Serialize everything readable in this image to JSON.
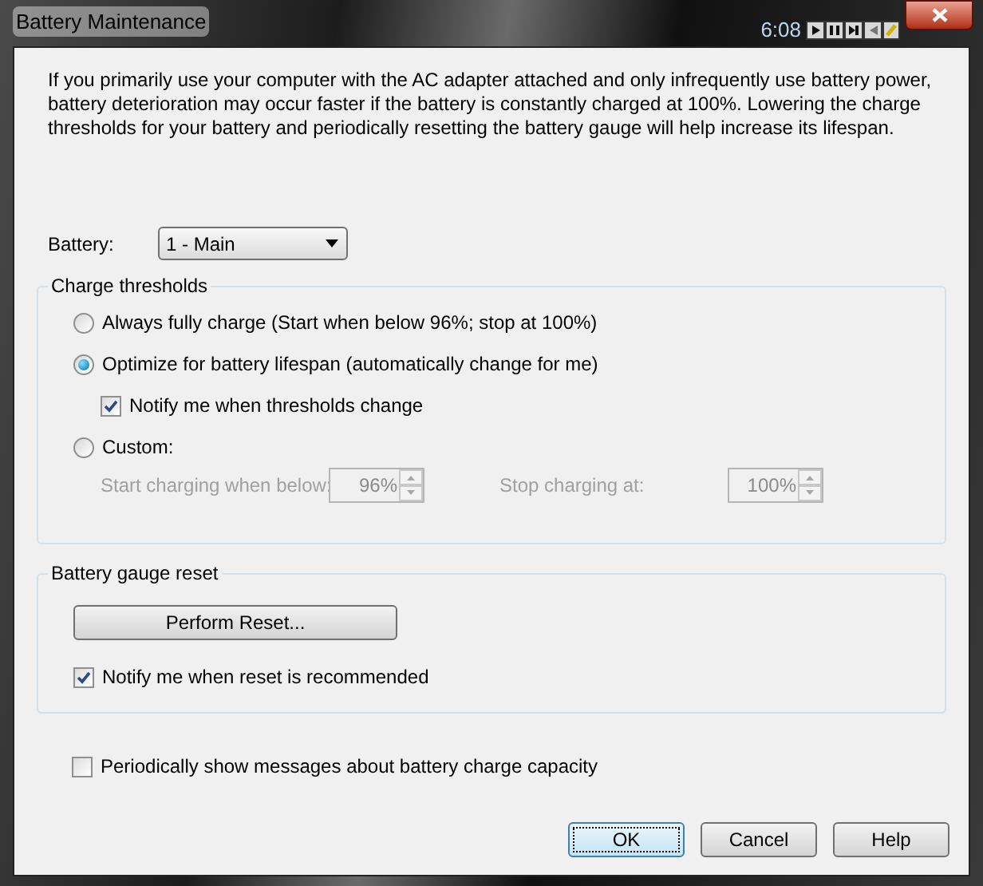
{
  "window": {
    "title": "Battery Maintenance",
    "clock": "6:08"
  },
  "intro": "If you primarily use your computer with the AC adapter attached and only infrequently use battery power, battery deterioration may occur faster if the battery is constantly charged at 100%. Lowering the charge thresholds for your battery and periodically resetting the battery gauge will help increase its lifespan.",
  "battery": {
    "label": "Battery:",
    "value": "1 - Main"
  },
  "charge_thresholds": {
    "title": "Charge thresholds",
    "items": [
      {
        "kind": "radio",
        "label": "Always fully charge (Start when below 96%; stop at 100%)",
        "selected": false
      },
      {
        "kind": "radio",
        "label": "Optimize for battery lifespan (automatically change for me)",
        "selected": true
      },
      {
        "kind": "checkbox",
        "label": "Notify me when thresholds change",
        "checked": true
      },
      {
        "kind": "radio",
        "label": "Custom:",
        "selected": false
      }
    ],
    "fields": [
      {
        "label": "Start charging when below:",
        "value": "96%",
        "disabled": true
      },
      {
        "label": "Stop charging at:",
        "value": "100%",
        "disabled": true
      }
    ]
  },
  "gauge_reset": {
    "title": "Battery gauge reset",
    "button": "Perform Reset...",
    "notify": {
      "label": "Notify me when reset is recommended",
      "checked": true
    }
  },
  "periodic": {
    "label": "Periodically show messages about battery charge capacity",
    "checked": false
  },
  "buttons": [
    {
      "label": "OK",
      "default": true
    },
    {
      "label": "Cancel",
      "default": false
    },
    {
      "label": "Help",
      "default": false
    }
  ]
}
